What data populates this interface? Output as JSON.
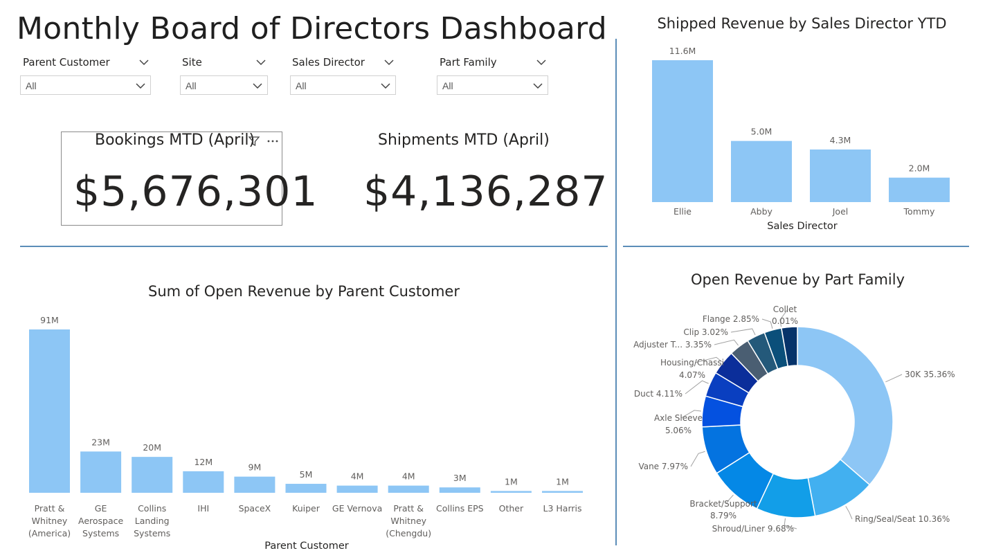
{
  "dashboard": {
    "title": "Monthly Board of Directors Dashboard"
  },
  "slicers": [
    {
      "label": "Parent Customer",
      "value": "All"
    },
    {
      "label": "Site",
      "value": "All"
    },
    {
      "label": "Sales Director",
      "value": "All"
    },
    {
      "label": "Part Family",
      "value": "All"
    }
  ],
  "cards": {
    "bookings": {
      "title": "Bookings MTD (April)",
      "value": "$5,676,301"
    },
    "shipments": {
      "title": "Shipments MTD (April)",
      "value": "$4,136,287"
    }
  },
  "icons": {
    "filter": "filter-icon",
    "more": "more-options-icon",
    "chevron": "chevron-down-icon"
  },
  "colors": {
    "bar": "#8dc6f5",
    "divider": "#5b8db8"
  },
  "chart_data": [
    {
      "id": "shipped",
      "type": "bar",
      "title": "Shipped Revenue by Sales Director YTD",
      "xlabel": "Sales Director",
      "ylabel": "",
      "categories": [
        "Ellie",
        "Abby",
        "Joel",
        "Tommy"
      ],
      "values": [
        11.6,
        5.0,
        4.3,
        2.0
      ],
      "labels": [
        "11.6M",
        "5.0M",
        "4.3M",
        "2.0M"
      ],
      "ylim": [
        0,
        11.6
      ],
      "grid": false
    },
    {
      "id": "open-customer",
      "type": "bar",
      "title": "Sum of Open Revenue by Parent Customer",
      "xlabel": "Parent Customer",
      "ylabel": "",
      "categories": [
        [
          "Pratt &",
          "Whitney",
          "(America)"
        ],
        [
          "GE",
          "Aerospace",
          "Systems"
        ],
        [
          "Collins",
          "Landing",
          "Systems"
        ],
        [
          "IHI"
        ],
        [
          "SpaceX"
        ],
        [
          "Kuiper"
        ],
        [
          "GE Vernova"
        ],
        [
          "Pratt &",
          "Whitney",
          "(Chengdu)"
        ],
        [
          "Collins EPS"
        ],
        [
          "Other"
        ],
        [
          "L3 Harris"
        ]
      ],
      "values": [
        91,
        23,
        20,
        12,
        9,
        5,
        4,
        4,
        3,
        1,
        1
      ],
      "labels": [
        "91M",
        "23M",
        "20M",
        "12M",
        "9M",
        "5M",
        "4M",
        "4M",
        "3M",
        "1M",
        "1M"
      ],
      "ylim": [
        0,
        91
      ],
      "grid": false
    },
    {
      "id": "part-family",
      "type": "pie",
      "donut": true,
      "title": "Open Revenue by Part Family",
      "slices": [
        {
          "name": "30K",
          "label": "30K 35.36%",
          "value": 35.36,
          "color": "#8dc6f5"
        },
        {
          "name": "Ring/Seal/Seat",
          "label": "Ring/Seal/Seat 10.36%",
          "value": 10.36,
          "color": "#42b0f0"
        },
        {
          "name": "Shroud/Liner",
          "label": "Shroud/Liner 9.68%",
          "value": 9.68,
          "color": "#129ee8"
        },
        {
          "name": "Bracket/Support",
          "label": "Bracket/Support 8.79%",
          "value": 8.79,
          "color": "#0488e6"
        },
        {
          "name": "Vane",
          "label": "Vane 7.97%",
          "value": 7.97,
          "color": "#0473e0"
        },
        {
          "name": "Axle Sleeve",
          "label": "Axle Sleeve 5.06%",
          "value": 5.06,
          "color": "#0451e0"
        },
        {
          "name": "Duct",
          "label": "Duct 4.11%",
          "value": 4.11,
          "color": "#0a3fc0"
        },
        {
          "name": "Housing/Chassi",
          "label": "Housing/Chassi 4.07%",
          "value": 4.07,
          "color": "#0b2e9a"
        },
        {
          "name": "Adjuster T...",
          "label": "Adjuster T... 3.35%",
          "value": 3.35,
          "color": "#4a5e72"
        },
        {
          "name": "Clip",
          "label": "Clip 3.02%",
          "value": 3.02,
          "color": "#24597a"
        },
        {
          "name": "Flange",
          "label": "Flange 2.85%",
          "value": 2.85,
          "color": "#0b4f7a"
        },
        {
          "name": "Collet",
          "label": "Collet 0.01%",
          "value": 0.01,
          "color": "#0a3e6e"
        },
        {
          "name": "",
          "label": "",
          "value": 2.6,
          "color": "#06336a"
        }
      ]
    }
  ]
}
